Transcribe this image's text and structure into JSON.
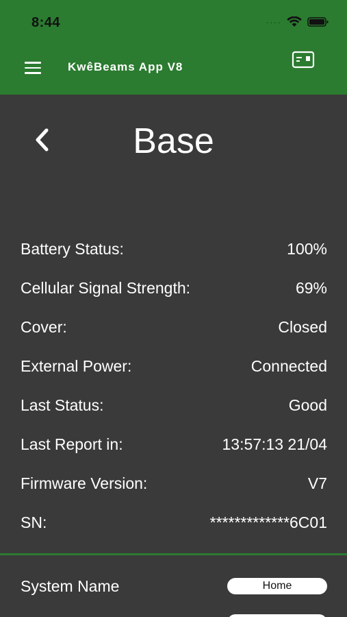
{
  "status_bar": {
    "time": "8:44"
  },
  "header": {
    "app_title": "KwêBeams App V8"
  },
  "page": {
    "title": "Base"
  },
  "info": [
    {
      "label": "Battery Status:",
      "value": "100%"
    },
    {
      "label": "Cellular Signal Strength:",
      "value": "69%"
    },
    {
      "label": "Cover:",
      "value": "Closed"
    },
    {
      "label": "External Power:",
      "value": "Connected"
    },
    {
      "label": "Last Status:",
      "value": "Good"
    },
    {
      "label": "Last Report in:",
      "value": "13:57:13 21/04"
    },
    {
      "label": "Firmware Version:",
      "value": "V7"
    },
    {
      "label": "SN:",
      "value": "*************6C01"
    }
  ],
  "system": {
    "name_label": "System Name",
    "name_value": "Home"
  },
  "colors": {
    "accent": "#2b7b30",
    "background": "#3a3a3a",
    "text": "#ffffff"
  }
}
